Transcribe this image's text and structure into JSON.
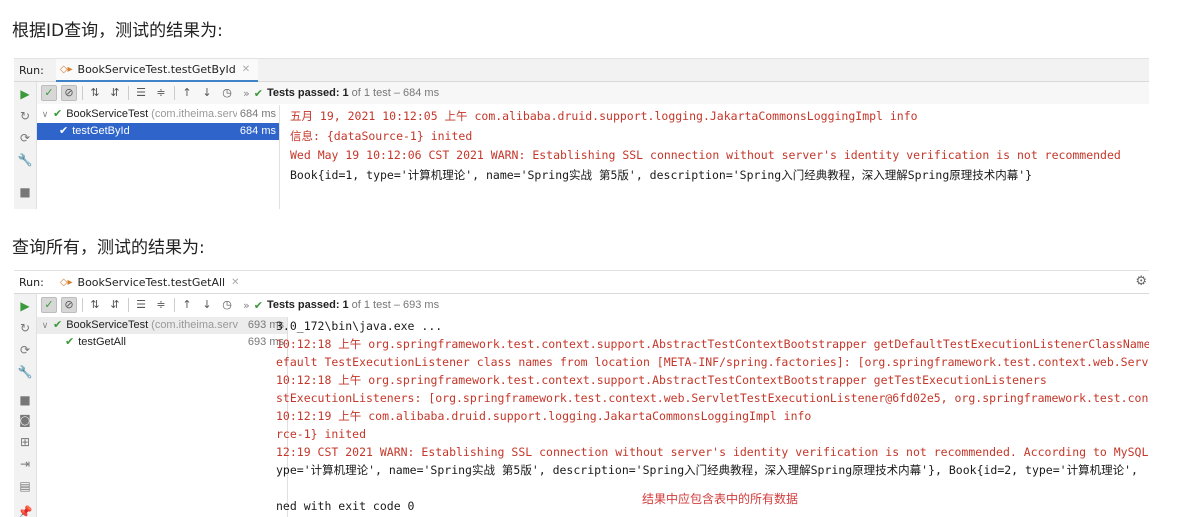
{
  "captions": {
    "by_id": "根据ID查询，测试的结果为:",
    "all": "查询所有，测试的结果为:"
  },
  "panel1": {
    "run_label": "Run:",
    "tab": "BookServiceTest.testGetById",
    "status": {
      "prefix": "Tests passed:",
      "count": "1",
      "suffix": "of 1 test – 684 ms"
    },
    "tree": [
      {
        "name": "BookServiceTest",
        "pkg": "(com.itheima.serv",
        "time": "684 ms"
      },
      {
        "name": "testGetById",
        "time": "684 ms"
      }
    ],
    "console": [
      {
        "text": "五月 19, 2021 10:12:05 上午 com.alibaba.druid.support.logging.JakartaCommonsLoggingImpl info",
        "color": "red"
      },
      {
        "text": "信息: {dataSource-1} inited",
        "color": "red"
      },
      {
        "text": "Wed May 19 10:12:06 CST 2021 WARN: Establishing SSL connection without server's identity verification is not recommended",
        "color": "red"
      },
      {
        "text": "Book{id=1, type='计算机理论', name='Spring实战 第5版', description='Spring入门经典教程，深入理解Spring原理技术内幕'}",
        "color": "dark"
      }
    ]
  },
  "panel2": {
    "run_label": "Run:",
    "tab": "BookServiceTest.testGetAll",
    "status": {
      "prefix": "Tests passed:",
      "count": "1",
      "suffix": "of 1 test – 693 ms"
    },
    "tree": [
      {
        "name": "BookServiceTest",
        "pkg": "(com.itheima.serv",
        "time": "693 ms"
      },
      {
        "name": "testGetAll",
        "time": "693 ms"
      }
    ],
    "console": [
      {
        "text": "3.0_172\\bin\\java.exe ...",
        "color": "dark"
      },
      {
        "text": "10:12:18 上午 org.springframework.test.context.support.AbstractTestContextBootstrapper getDefaultTestExecutionListenerClassNames",
        "color": "red"
      },
      {
        "text": "efault TestExecutionListener class names from location [META-INF/spring.factories]: [org.springframework.test.context.web.ServletTest",
        "color": "red"
      },
      {
        "text": "10:12:18 上午 org.springframework.test.context.support.AbstractTestContextBootstrapper getTestExecutionListeners",
        "color": "red"
      },
      {
        "text": "stExecutionListeners: [org.springframework.test.context.web.ServletTestExecutionListener@6fd02e5, org.springframework.test.context",
        "color": "red"
      },
      {
        "text": "10:12:19 上午 com.alibaba.druid.support.logging.JakartaCommonsLoggingImpl info",
        "color": "red"
      },
      {
        "text": "rce-1} inited",
        "color": "red"
      },
      {
        "text": "12:19 CST 2021 WARN: Establishing SSL connection without server's identity verification is not recommended. According to MySQL",
        "color": "red"
      },
      {
        "text": "ype='计算机理论', name='Spring实战 第5版', description='Spring入门经典教程，深入理解Spring原理技术内幕'}, Book{id=2, type='计算机理论',",
        "color": "dark"
      },
      {
        "text": "",
        "color": "dark"
      },
      {
        "text": "ned with exit code 0",
        "color": "dark"
      }
    ],
    "note": "结果中应包含表中的所有数据"
  },
  "colors": {
    "green": "#3b9a3b",
    "red_log": "#c4372a",
    "selection": "#2f65ca",
    "note": "#d33b3b"
  }
}
